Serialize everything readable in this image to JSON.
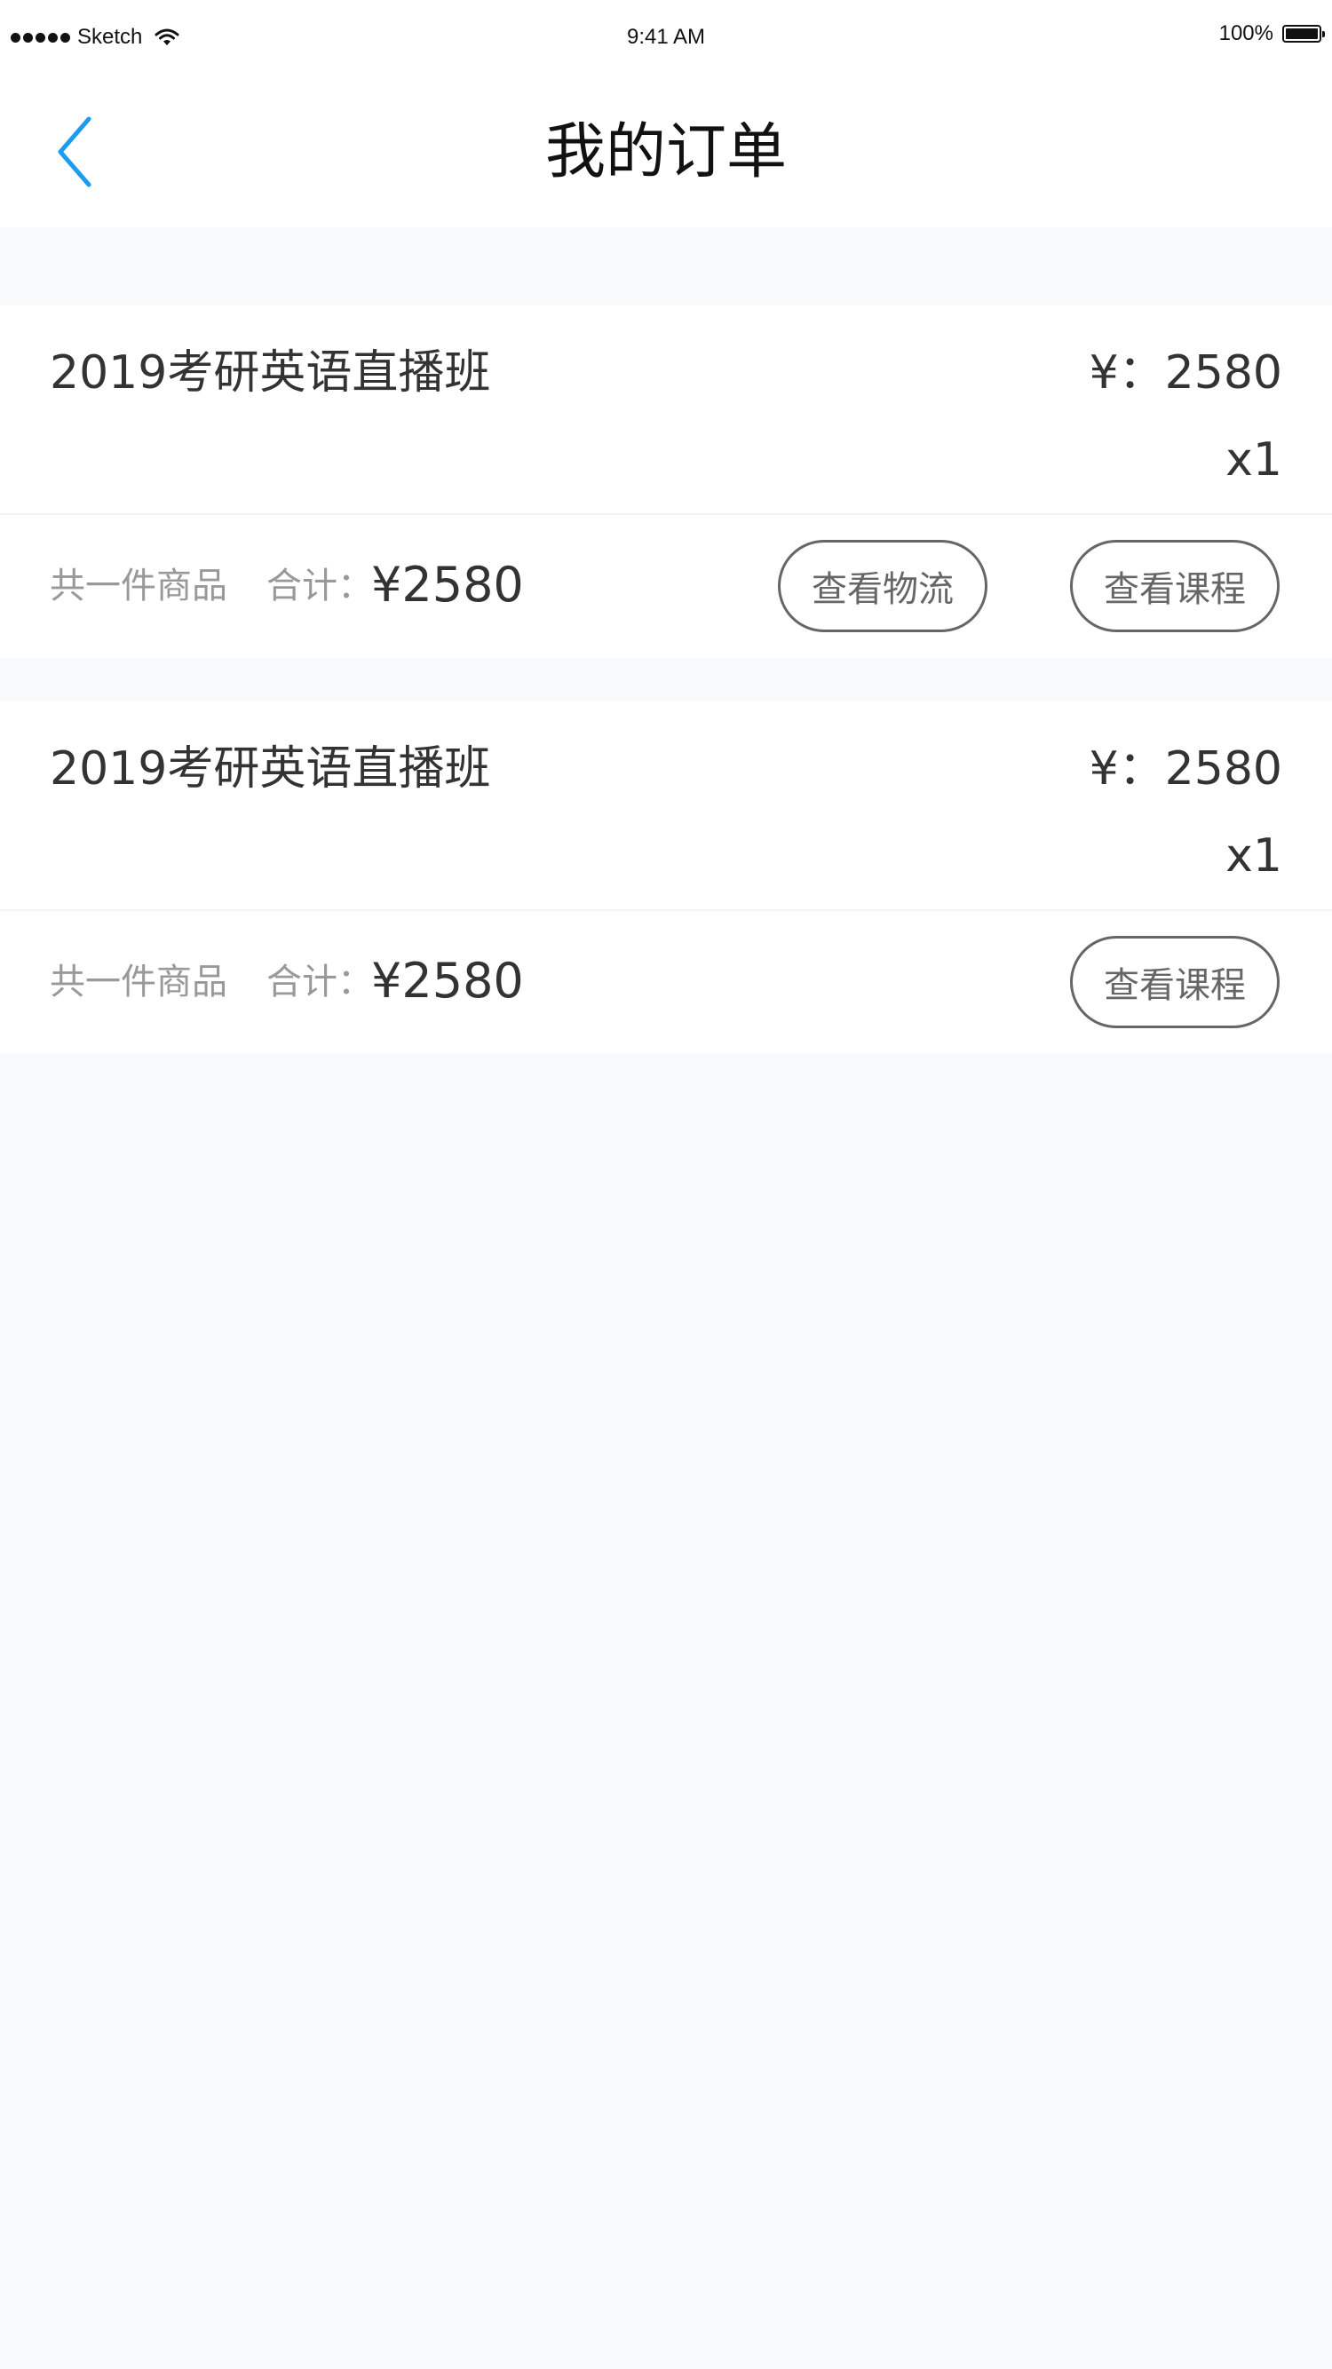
{
  "status_bar": {
    "carrier": "Sketch",
    "time": "9:41 AM",
    "battery": "100%"
  },
  "nav": {
    "title": "我的订单"
  },
  "orders": [
    {
      "course_name": "2019考研英语直播班",
      "unit_price": "¥：2580",
      "quantity": "x1",
      "count_text": "共一件商品",
      "total_label": "合计：",
      "total_value": "¥2580",
      "buttons": {
        "logistics": "查看物流",
        "course": "查看课程"
      }
    },
    {
      "course_name": "2019考研英语直播班",
      "unit_price": "¥：2580",
      "quantity": "x1",
      "count_text": "共一件商品",
      "total_label": "合计：",
      "total_value": "¥2580",
      "buttons": {
        "course": "查看课程"
      }
    }
  ],
  "colors": {
    "accent": "#1a9cf0",
    "page_bg": "#f8f9fb",
    "card_bg": "#ffffff",
    "text_primary": "#333333",
    "text_secondary": "#999999",
    "button_border": "#666666"
  }
}
